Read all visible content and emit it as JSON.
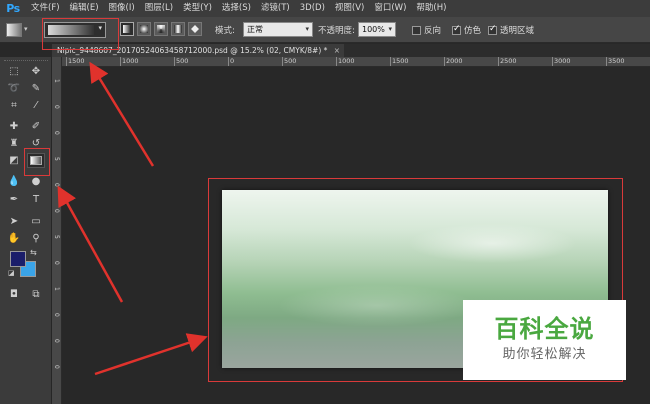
{
  "app": {
    "logo": "Ps"
  },
  "menubar": {
    "items": [
      "文件(F)",
      "编辑(E)",
      "图像(I)",
      "图层(L)",
      "类型(Y)",
      "选择(S)",
      "滤镜(T)",
      "3D(D)",
      "视图(V)",
      "窗口(W)",
      "帮助(H)"
    ]
  },
  "options": {
    "mode_label": "模式:",
    "mode_value": "正常",
    "opacity_label": "不透明度:",
    "opacity_value": "100%",
    "reverse_label": "反向",
    "reverse_checked": false,
    "dither_label": "仿色",
    "dither_checked": true,
    "transparency_label": "透明区域",
    "transparency_checked": true
  },
  "document": {
    "tab_title": "Nipic_9448607_20170524063458712000.psd @ 15.2% (02, CMYK/8#) *",
    "close_glyph": "×"
  },
  "ruler": {
    "h_labels": [
      "1500",
      "1000",
      "500",
      "0",
      "500",
      "1000",
      "1500",
      "2000",
      "2500",
      "3000",
      "3500",
      "4000",
      "4500",
      "5000"
    ],
    "v_labels": [
      "1",
      "0",
      "0",
      "5",
      "0",
      "0",
      "5",
      "0",
      "1",
      "0",
      "0",
      "0"
    ]
  },
  "toolbar": {
    "tools": [
      {
        "name": "marquee-tool",
        "glyph": "⬚"
      },
      {
        "name": "move-tool",
        "glyph": "✥"
      },
      {
        "name": "lasso-tool",
        "glyph": "➰"
      },
      {
        "name": "quick-select-tool",
        "glyph": "✎"
      },
      {
        "name": "crop-tool",
        "glyph": "⌗"
      },
      {
        "name": "eyedropper-tool",
        "glyph": "⁄"
      },
      {
        "name": "healing-tool",
        "glyph": "✚"
      },
      {
        "name": "brush-tool",
        "glyph": "✐"
      },
      {
        "name": "stamp-tool",
        "glyph": "♜"
      },
      {
        "name": "history-brush-tool",
        "glyph": "↺"
      },
      {
        "name": "eraser-tool",
        "glyph": "◩"
      },
      {
        "name": "gradient-tool",
        "glyph": ""
      },
      {
        "name": "blur-tool",
        "glyph": "💧"
      },
      {
        "name": "dodge-tool",
        "glyph": "●"
      },
      {
        "name": "pen-tool",
        "glyph": "✒"
      },
      {
        "name": "type-tool",
        "glyph": "T"
      },
      {
        "name": "path-select-tool",
        "glyph": "➤"
      },
      {
        "name": "shape-tool",
        "glyph": "▭"
      },
      {
        "name": "hand-tool",
        "glyph": "✋"
      },
      {
        "name": "zoom-tool",
        "glyph": "⚲"
      },
      {
        "name": "quick-mask-icon",
        "glyph": "◘"
      },
      {
        "name": "screen-mode-icon",
        "glyph": "⧉"
      }
    ],
    "foreground_color": "#1b1e6a",
    "background_color": "#3aa4e8"
  },
  "watermark": {
    "title": "百科全说",
    "subtitle": "助你轻松解决"
  },
  "colors": {
    "highlight": "#d93a3a",
    "panel": "#3b3b3b",
    "workspace": "#282828"
  }
}
